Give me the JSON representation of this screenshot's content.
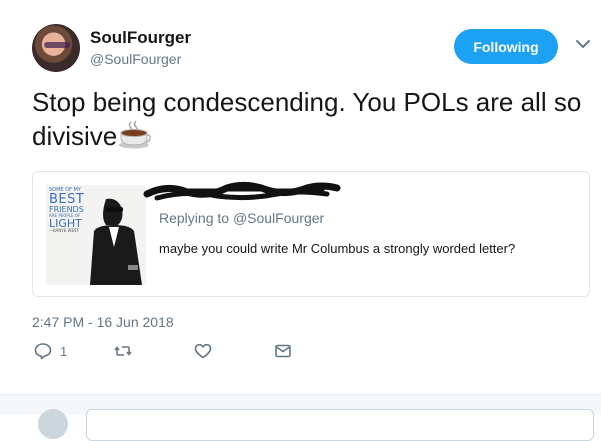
{
  "author": {
    "display_name": "SoulFourger",
    "handle": "@SoulFourger"
  },
  "follow_button": {
    "label": "Following"
  },
  "tweet": {
    "text": "Stop being condescending. You POLs are all so divisive",
    "emoji": "hot-beverage-icon"
  },
  "quoted_tweet": {
    "image_text": {
      "line1": "SOME OF MY",
      "line2": "BEST",
      "line3": "FRIENDS",
      "line4": "ARE PEOPLE OF",
      "line5": "LIGHT",
      "line6": "—KANYE WEST"
    },
    "replying_to_label": "Replying to",
    "replying_to_handle": "@SoulFourger",
    "text": "maybe you could write Mr Columbus a strongly worded letter?"
  },
  "timestamp": "2:47 PM - 16 Jun 2018",
  "actions": {
    "reply_count": "1",
    "retweet_count": "",
    "like_count": ""
  },
  "colors": {
    "accent": "#1da1f2",
    "secondary_text": "#657786",
    "border": "#e1e8ed"
  }
}
